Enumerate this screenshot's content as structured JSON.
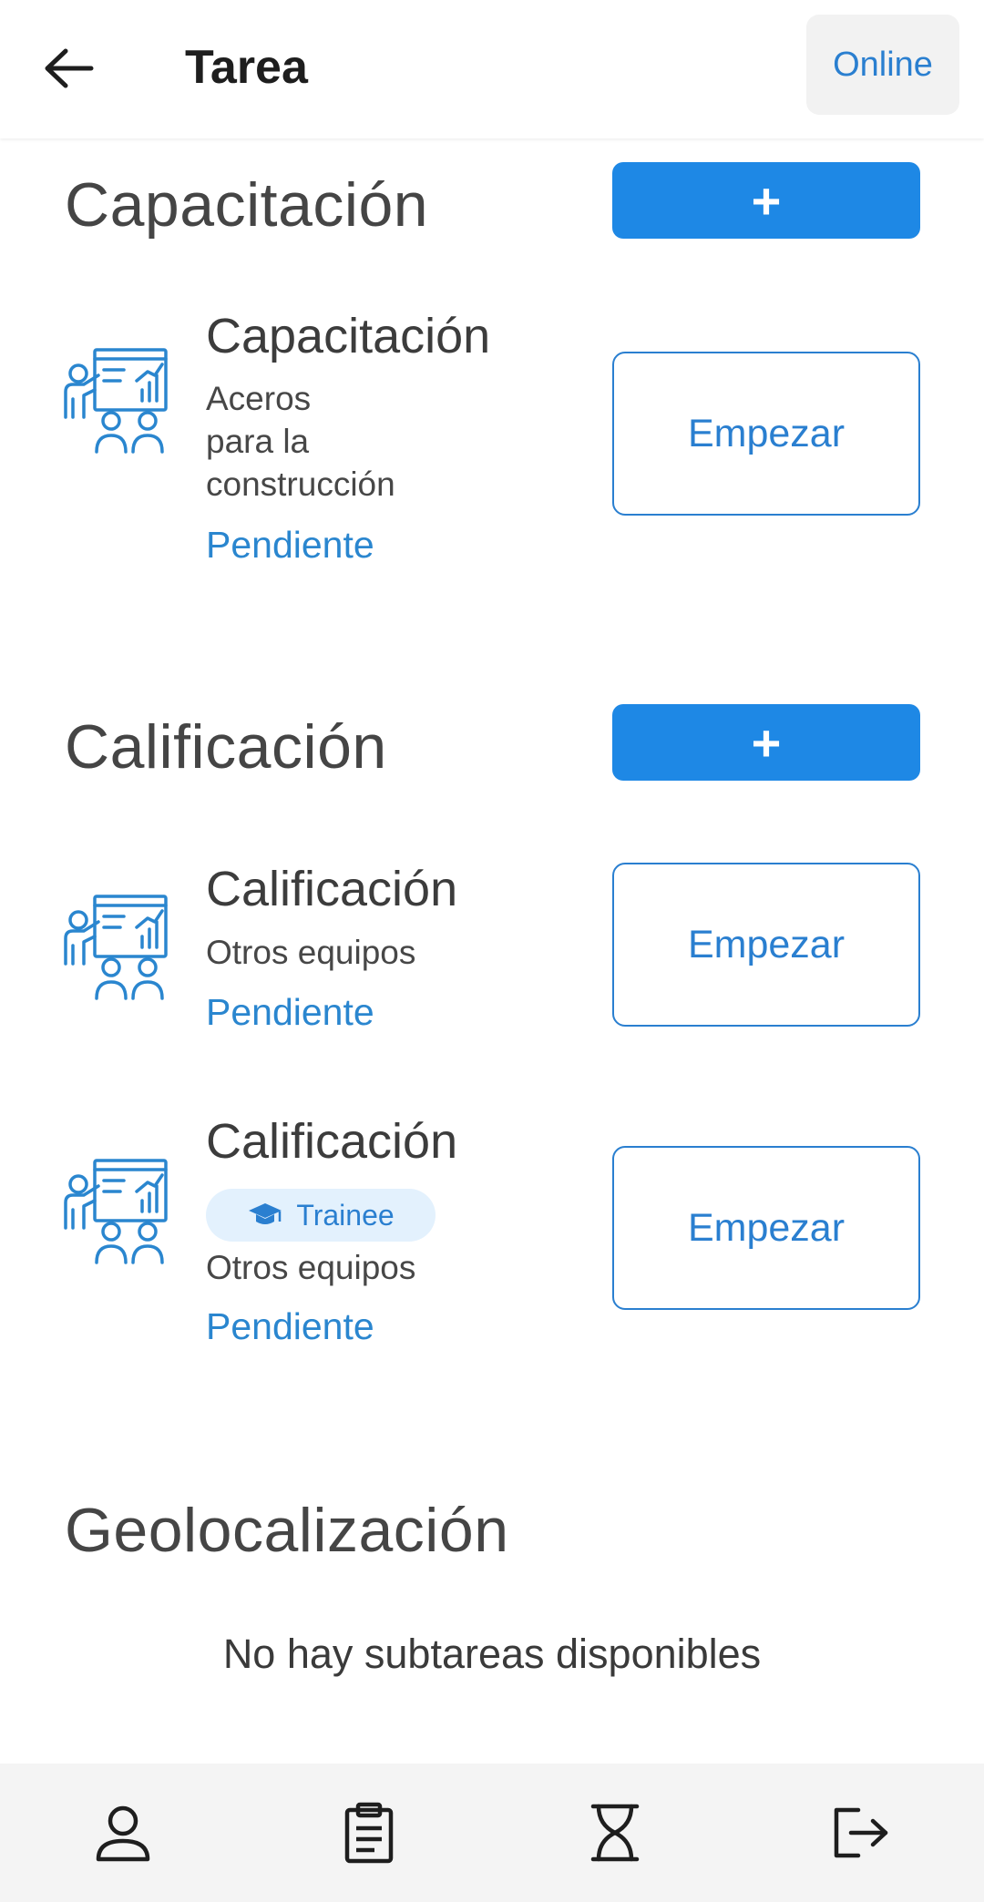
{
  "header": {
    "title": "Tarea",
    "status_button": "Online"
  },
  "sections": [
    {
      "title": "Capacitación",
      "add_label": "+",
      "items": [
        {
          "title": "Capacitación",
          "subtitle_lines": [
            "Aceros",
            "para la",
            "construcción"
          ],
          "status": "Pendiente",
          "action": "Empezar",
          "icon": "training-presentation-icon"
        }
      ]
    },
    {
      "title": "Calificación",
      "add_label": "+",
      "items": [
        {
          "title": "Calificación",
          "subtitle_lines": [
            "Otros equipos"
          ],
          "status": "Pendiente",
          "action": "Empezar",
          "icon": "training-presentation-icon"
        },
        {
          "title": "Calificación",
          "badge": "Trainee",
          "subtitle_lines": [
            "Otros equipos"
          ],
          "status": "Pendiente",
          "action": "Empezar",
          "icon": "training-presentation-icon"
        }
      ]
    },
    {
      "title": "Geolocalización",
      "empty_message": "No hay subtareas disponibles"
    }
  ],
  "bottom_nav": [
    {
      "icon": "user-icon"
    },
    {
      "icon": "clipboard-icon"
    },
    {
      "icon": "hourglass-icon"
    },
    {
      "icon": "logout-icon"
    }
  ],
  "colors": {
    "accent": "#1e88e5",
    "link": "#2a7fd0",
    "badge_bg": "#e3f1fd"
  }
}
